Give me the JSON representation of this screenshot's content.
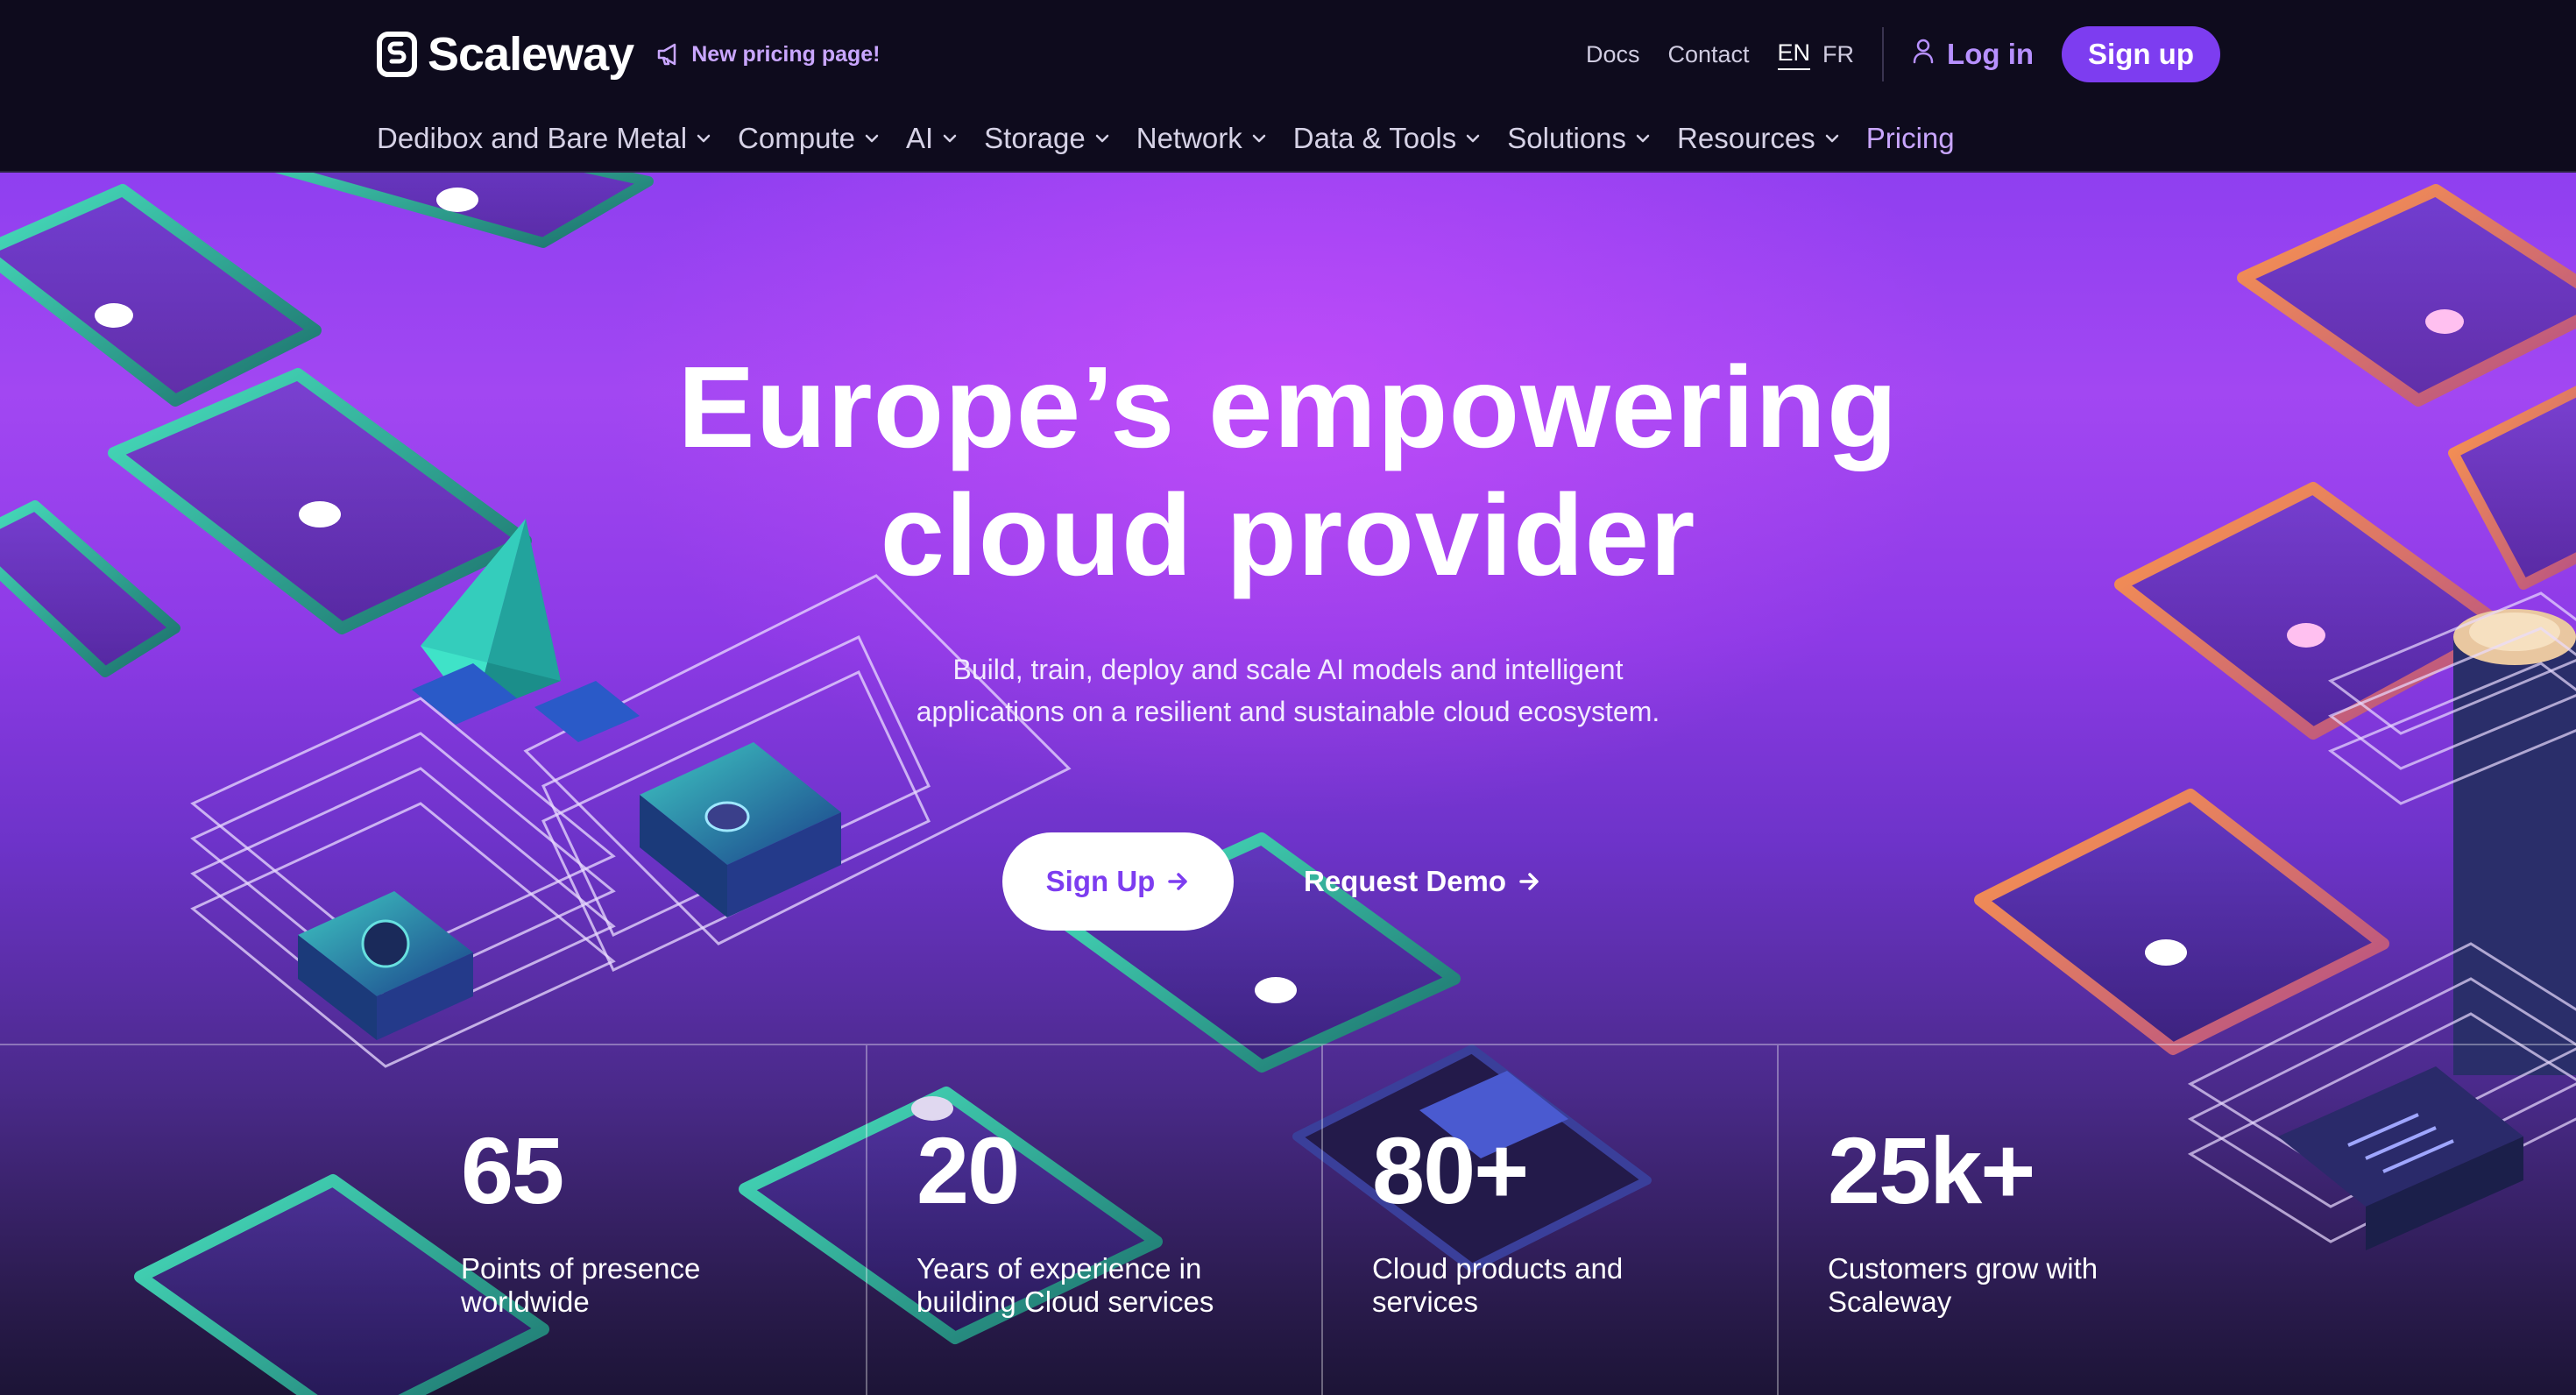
{
  "header": {
    "brand": "Scaleway",
    "promo": "New pricing page!",
    "links": {
      "docs": "Docs",
      "contact": "Contact"
    },
    "lang": {
      "active": "EN",
      "other": "FR"
    },
    "login": "Log in",
    "signup": "Sign up"
  },
  "nav": {
    "items": [
      {
        "label": "Dedibox and Bare Metal"
      },
      {
        "label": "Compute"
      },
      {
        "label": "AI"
      },
      {
        "label": "Storage"
      },
      {
        "label": "Network"
      },
      {
        "label": "Data & Tools"
      },
      {
        "label": "Solutions"
      },
      {
        "label": "Resources"
      },
      {
        "label": "Pricing"
      }
    ]
  },
  "hero": {
    "title_line1": "Europe’s empowering",
    "title_line2": "cloud provider",
    "subtitle": "Build, train, deploy and scale AI models and intelligent applications on a resilient and sustainable cloud ecosystem.",
    "cta_primary": "Sign Up",
    "cta_secondary": "Request Demo"
  },
  "stats": [
    {
      "value": "65",
      "label": "Points of presence worldwide"
    },
    {
      "value": "20",
      "label": "Years of experience in building Cloud services"
    },
    {
      "value": "80+",
      "label": "Cloud products and services"
    },
    {
      "value": "25k+",
      "label": "Customers grow with Scaleway"
    }
  ],
  "icons": {
    "logo": "scaleway-logo-icon",
    "promo": "megaphone-icon",
    "login": "user-icon",
    "nav_dropdown": "chevron-down-icon",
    "cta": "arrow-right-icon"
  },
  "colors": {
    "header_bg": "#0e0b1d",
    "accent": "#7d3df0",
    "accent_light": "#c9a6ff",
    "hero_top": "#a247f2",
    "hero_bottom": "#1c1436"
  }
}
